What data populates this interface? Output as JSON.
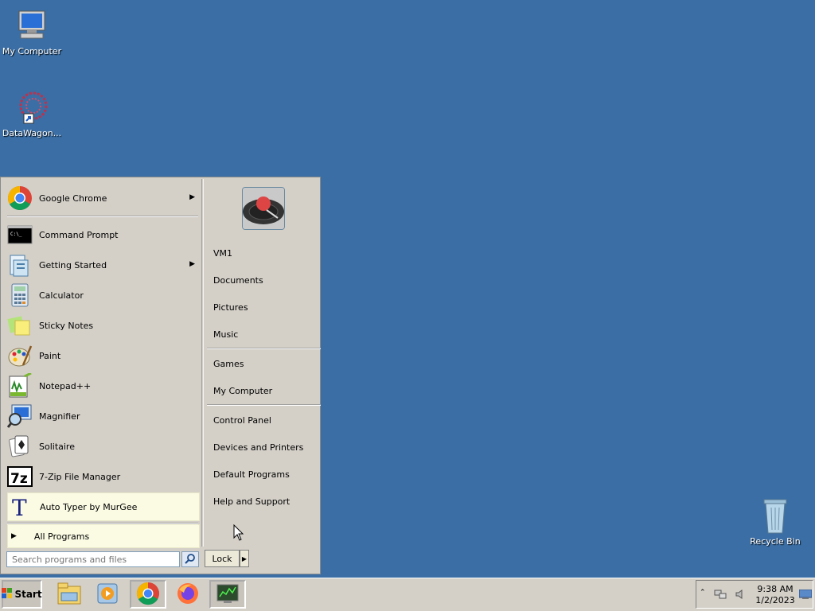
{
  "desktop": {
    "icons": [
      {
        "label": "My Computer",
        "icon": "computer-icon"
      },
      {
        "label": "DataWagon...",
        "icon": "datawagon-icon"
      },
      {
        "label": "Recycle Bin",
        "icon": "recycle-bin-icon"
      }
    ],
    "background_color": "#3a6ea5"
  },
  "start_menu": {
    "pinned": [
      {
        "label": "Google Chrome",
        "icon": "chrome-icon",
        "has_submenu": true
      }
    ],
    "recent": [
      {
        "label": "Command Prompt",
        "icon": "command-prompt-icon"
      },
      {
        "label": "Getting Started",
        "icon": "getting-started-icon",
        "has_submenu": true
      },
      {
        "label": "Calculator",
        "icon": "calculator-icon"
      },
      {
        "label": "Sticky Notes",
        "icon": "sticky-notes-icon"
      },
      {
        "label": "Paint",
        "icon": "paint-icon"
      },
      {
        "label": "Notepad++",
        "icon": "notepadpp-icon"
      },
      {
        "label": "Magnifier",
        "icon": "magnifier-icon"
      },
      {
        "label": "Solitaire",
        "icon": "solitaire-icon"
      },
      {
        "label": "7-Zip File Manager",
        "icon": "7zip-icon"
      },
      {
        "label": "Auto Typer by MurGee",
        "icon": "auto-typer-icon"
      }
    ],
    "all_programs_label": "All Programs",
    "right": {
      "group1": [
        "VM1",
        "Documents",
        "Pictures",
        "Music"
      ],
      "group2": [
        "Games",
        "My Computer"
      ],
      "group3": [
        "Control Panel",
        "Devices and Printers",
        "Default Programs",
        "Help and Support"
      ]
    },
    "search_placeholder": "Search programs and files",
    "lock_label": "Lock"
  },
  "taskbar": {
    "start_label": "Start",
    "buttons": [
      {
        "icon": "file-explorer-icon"
      },
      {
        "icon": "media-player-icon"
      },
      {
        "icon": "chrome-icon",
        "active": true
      },
      {
        "icon": "firefox-icon"
      },
      {
        "icon": "task-manager-icon"
      }
    ],
    "clock_time": "9:38 AM",
    "clock_date": "1/2/2023"
  }
}
